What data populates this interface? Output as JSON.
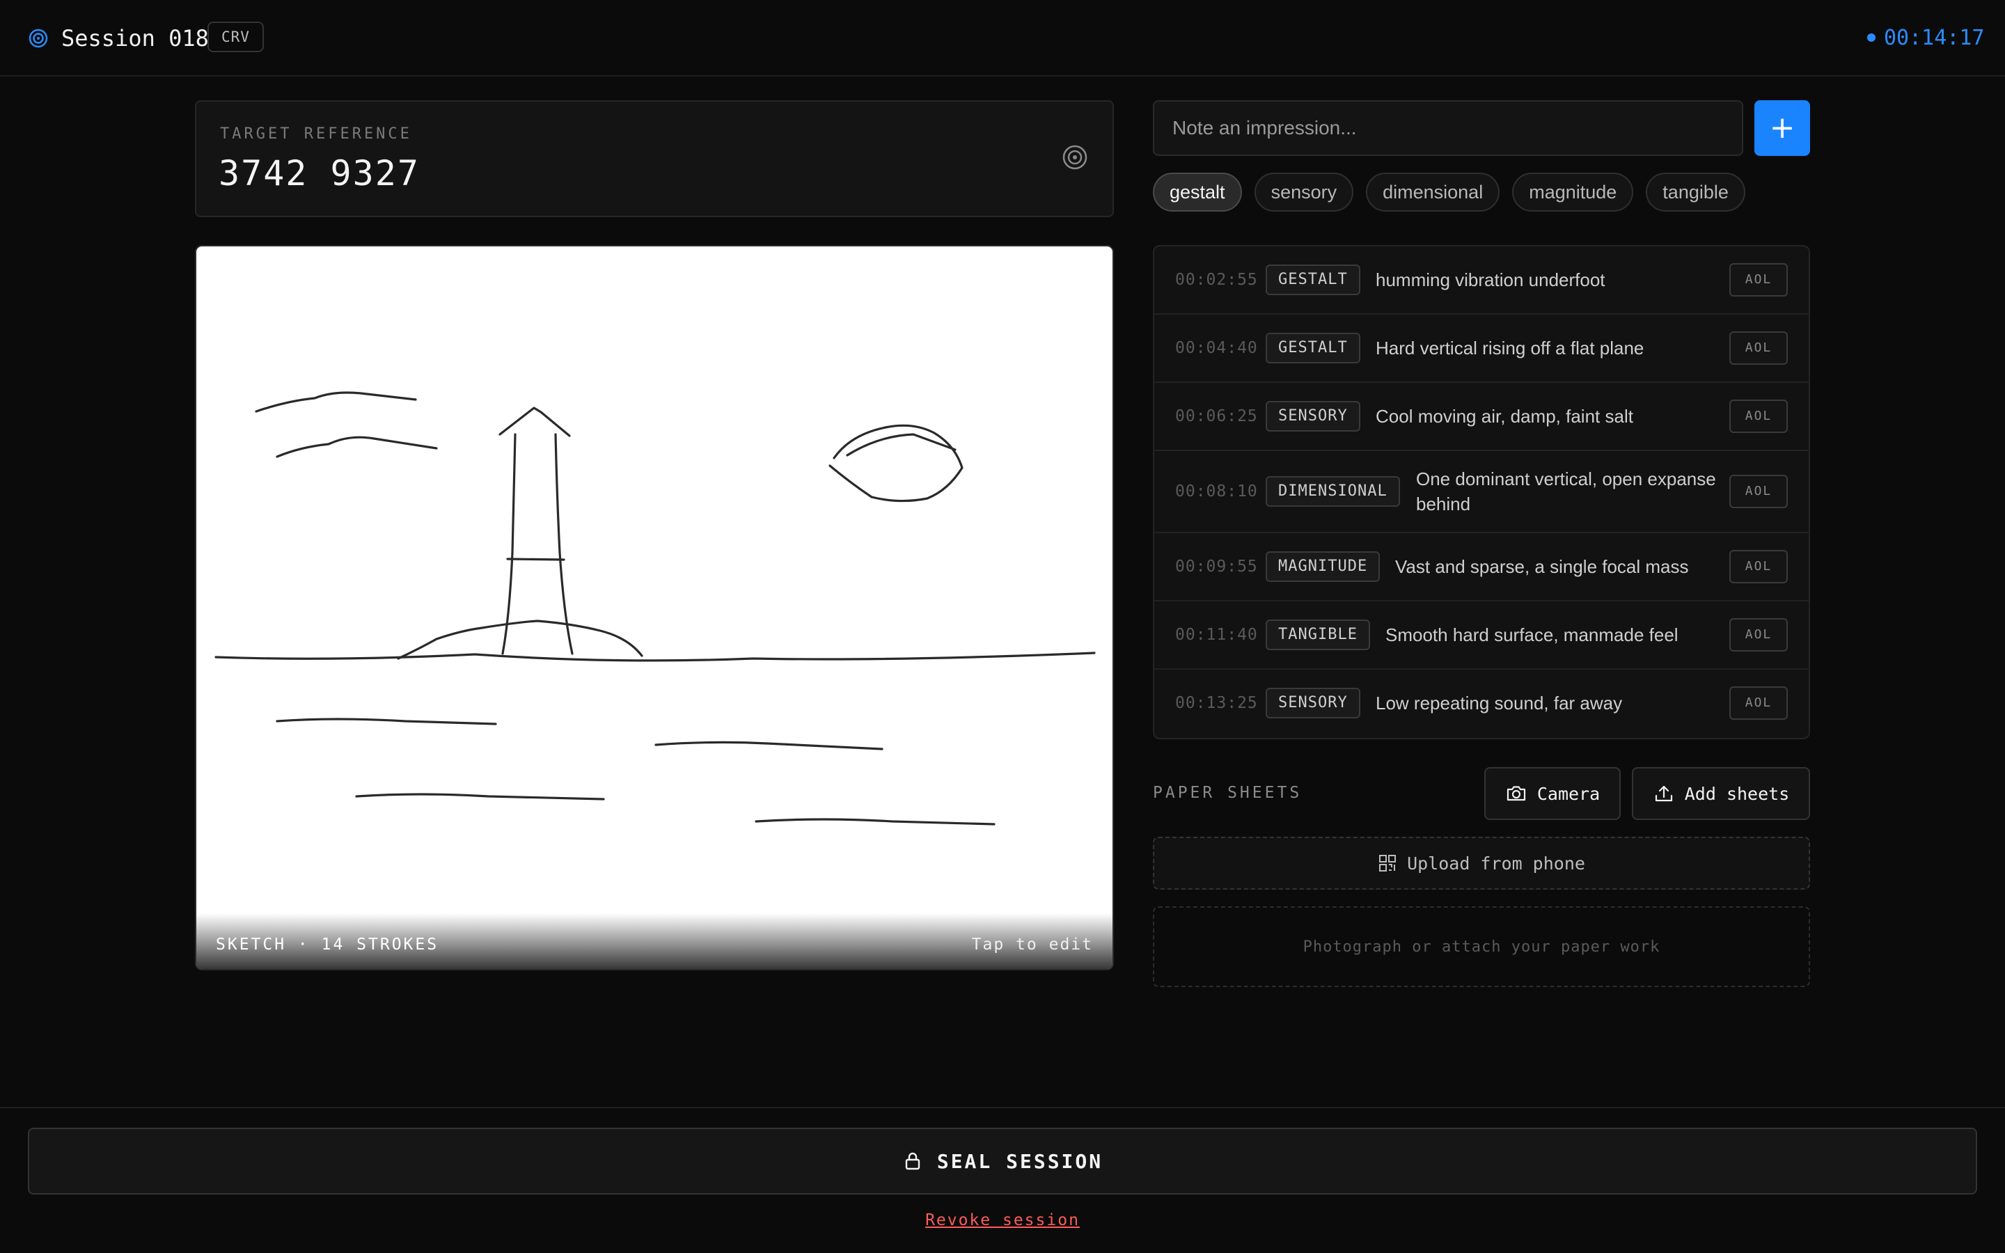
{
  "header": {
    "title": "Session 018",
    "method_badge": "CRV",
    "timer": "00:14:17",
    "accent_color": "#1a84ff",
    "brand_icon": "target-icon"
  },
  "target": {
    "label": "TARGET REFERENCE",
    "value": "3742 9327",
    "icon": "target-icon"
  },
  "sketch": {
    "stats": "SKETCH · 14 STROKES",
    "edit_label": "Tap to edit"
  },
  "impression": {
    "placeholder": "Note an impression...",
    "add_icon": "plus-icon"
  },
  "chips": [
    {
      "label": "gestalt",
      "active": true
    },
    {
      "label": "sensory",
      "active": false
    },
    {
      "label": "dimensional",
      "active": false
    },
    {
      "label": "magnitude",
      "active": false
    },
    {
      "label": "tangible",
      "active": false
    }
  ],
  "log": [
    {
      "time": "00:02:55",
      "tag": "GESTALT",
      "text": "humming vibration underfoot",
      "action": "AOL"
    },
    {
      "time": "00:04:40",
      "tag": "GESTALT",
      "text": "Hard vertical rising off a flat plane",
      "action": "AOL"
    },
    {
      "time": "00:06:25",
      "tag": "SENSORY",
      "text": "Cool moving air, damp, faint salt",
      "action": "AOL"
    },
    {
      "time": "00:08:10",
      "tag": "DIMENSIONAL",
      "text": "One dominant vertical, open expanse behind",
      "action": "AOL"
    },
    {
      "time": "00:09:55",
      "tag": "MAGNITUDE",
      "text": "Vast and sparse, a single focal mass",
      "action": "AOL"
    },
    {
      "time": "00:11:40",
      "tag": "TANGIBLE",
      "text": "Smooth hard surface, manmade feel",
      "action": "AOL"
    },
    {
      "time": "00:13:25",
      "tag": "SENSORY",
      "text": "Low repeating sound, far away",
      "action": "AOL"
    }
  ],
  "paper": {
    "label": "PAPER SHEETS",
    "camera_label": "Camera",
    "add_sheets_label": "Add sheets",
    "upload_phone_label": "Upload from phone",
    "dropzone_text": "Photograph or attach your paper work"
  },
  "footer": {
    "seal_label": "SEAL SESSION",
    "revoke_label": "Revoke session",
    "danger_color": "#ff5b5b"
  }
}
